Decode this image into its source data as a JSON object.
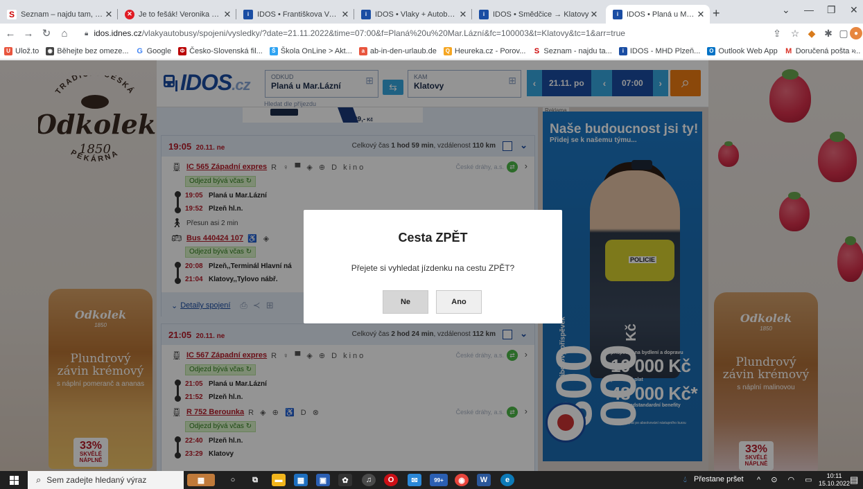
{
  "browser": {
    "tabs": [
      {
        "title": "Seznam – najdu tam, co nezn",
        "icon": "seznam-icon",
        "active": false
      },
      {
        "title": "Je to fešák! Veronika Žilková",
        "icon": "red-circle-icon",
        "active": false
      },
      {
        "title": "IDOS • Františkova Ves/Petro",
        "icon": "idos-icon",
        "active": false
      },
      {
        "title": "IDOS • Vlaky + Autobusy • V",
        "icon": "idos-icon",
        "active": false
      },
      {
        "title": "IDOS • Smědčice → Klatovy",
        "icon": "idos-icon",
        "active": false
      },
      {
        "title": "IDOS • Planá u Mar.Lázní → ",
        "icon": "idos-icon",
        "active": true
      }
    ],
    "url_host": "idos.idnes.cz",
    "url_path": "/vlakyautobusy/spojeni/vysledky/?date=21.11.2022&time=07:00&f=Planá%20u%20Mar.Lázní&fc=100003&t=Klatovy&tc=1&arr=true",
    "bookmarks": [
      {
        "label": "Ulož.to",
        "icon": "ulozto-icon",
        "color": "#e8553e"
      },
      {
        "label": "Běhejte bez omeze...",
        "icon": "globe-icon",
        "color": "#444444"
      },
      {
        "label": "Google",
        "icon": "google-icon",
        "color": "#4285f4"
      },
      {
        "label": "Česko-Slovenská fil...",
        "icon": "csfd-icon",
        "color": "#ba0305"
      },
      {
        "label": "Škola OnLine > Akt...",
        "icon": "skola-icon",
        "color": "#2ea3f2"
      },
      {
        "label": "ab-in-den-urlaub.de",
        "icon": "urlaub-icon",
        "color": "#e8553e"
      },
      {
        "label": "Heureka.cz - Porov...",
        "icon": "heureka-icon",
        "color": "#f5a623"
      },
      {
        "label": "Seznam - najdu ta...",
        "icon": "seznam-icon",
        "color": "#cc0000"
      },
      {
        "label": "IDOS - MHD Plzeň...",
        "icon": "idos-icon",
        "color": "#1a4da3"
      },
      {
        "label": "Outlook Web App",
        "icon": "outlook-icon",
        "color": "#0072c6"
      },
      {
        "label": "Doručená pošta -...",
        "icon": "gmail-icon",
        "color": "#d93025"
      }
    ],
    "bookmarks_more": "»"
  },
  "sidebar_left": {
    "brand_arc": "TRADIČNÍ ČESKÁ",
    "brand": "Odkolek",
    "year": "1850",
    "brand_arc_bottom": "PEKÁRNA",
    "pack_name_1": "Plundrový",
    "pack_name_2": "závin krémový",
    "pack_fill": "s náplní pomeranč a ananas",
    "pack_pct": "33%",
    "pack_pct_sub": "SKVĚLÉ NÁPLNĚ"
  },
  "sidebar_right": {
    "pack_brand": "Odkolek",
    "pack_year": "1850",
    "pack_name_1": "Plundrový",
    "pack_name_2": "závin krémový",
    "pack_fill": "s náplní malinovou",
    "pack_pct": "33%",
    "pack_pct_sub": "SKVĚLÉ NÁPLNĚ"
  },
  "idos": {
    "logo": "IDOS",
    "logo_tld": ".cz",
    "from_label": "ODKUD",
    "from_value": "Planá u Mar.Lázní",
    "to_label": "KAM",
    "to_value": "Klatovy",
    "arrival_hint": "Hledat dle příjezdu",
    "date": "21.11. po",
    "time": "07:00",
    "top_ad_num": "29,-",
    "top_ad_unit": "Kč"
  },
  "connections": [
    {
      "time": "19:05",
      "date": "20.11. ne",
      "total_label": "Celkový čas ",
      "total_time": "1 hod 59 min",
      "dist_label": ", vzdálenost ",
      "dist": "110 km",
      "segments": [
        {
          "type": "train",
          "link": "IC 565 Západní expres",
          "amenities": "R ♀ ▀ ◈ ⊕ D kino",
          "carrier": "České dráhy, a.s.",
          "status": "Odjezd bývá včas",
          "stops": [
            {
              "time": "19:05",
              "name": "Planá u Mar.Lázní"
            },
            {
              "time": "19:52",
              "name": "Plzeň hl.n."
            }
          ]
        },
        {
          "type": "walk",
          "text": "Přesun asi 2 min"
        },
        {
          "type": "bus",
          "link": "Bus 440424 107",
          "amenities": "♿ ◈",
          "carrier": "",
          "status": "Odjezd bývá včas",
          "stops": [
            {
              "time": "20:08",
              "name": "Plzeň,,Terminál Hlavní ná"
            },
            {
              "time": "21:04",
              "name": "Klatovy,,Tylovo nábř."
            }
          ]
        }
      ],
      "details": "Detaily spojení"
    },
    {
      "time": "21:05",
      "date": "20.11. ne",
      "total_label": "Celkový čas ",
      "total_time": "2 hod 24 min",
      "dist_label": ", vzdálenost ",
      "dist": "112 km",
      "segments": [
        {
          "type": "train",
          "link": "IC 567 Západní expres",
          "amenities": "R ♀ ▀ ◈ ⊕ D kino",
          "carrier": "České dráhy, a.s.",
          "status": "Odjezd bývá včas",
          "stops": [
            {
              "time": "21:05",
              "name": "Planá u Mar.Lázní"
            },
            {
              "time": "21:52",
              "name": "Plzeň hl.n."
            }
          ]
        },
        {
          "type": "train",
          "link": "R 752 Berounka",
          "amenities": "R ◈ ⊕ ♿ D ⊗",
          "carrier": "České dráhy, a.s.",
          "status": "Odjezd bývá včas",
          "stops": [
            {
              "time": "22:40",
              "name": "Plzeň hl.n."
            },
            {
              "time": "23:29",
              "name": "Klatovy"
            }
          ]
        }
      ]
    }
  ],
  "ad": {
    "label": "Reklama",
    "headline": "Naše budoucnost jsi ty!",
    "subline": "Přidej se k našemu týmu...",
    "big_num": "300 000",
    "big_unit": "Kč",
    "vertical": "náborový příspěvek",
    "vest": "POLICIE",
    "t1": "příspěvek na bydlení a dopravu",
    "t2": "10 000 Kč",
    "t3": "průměrný plat",
    "t4": "48 000 Kč*",
    "t5": "a další nadstandardní benefity",
    "t6": "* průměrný plat po absolvování nástupního kurzu",
    "seal": "MĚSTSKÁ POLICIE PRAHA"
  },
  "modal": {
    "title": "Cesta ZPĚT",
    "text": "Přejete si vyhledat jízdenku na cestu ZPĚT?",
    "btn_no": "Ne",
    "btn_yes": "Ano"
  },
  "taskbar": {
    "search_placeholder": "Sem zadejte hledaný výraz",
    "weather": "Přestane pršet",
    "time": "10:11",
    "date": "15.10.2022",
    "badge": "99+"
  }
}
